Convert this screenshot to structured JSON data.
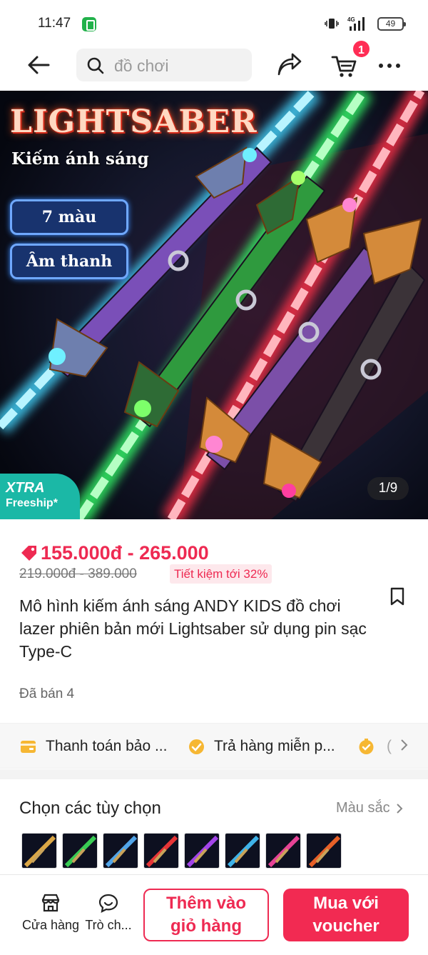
{
  "status_bar": {
    "time": "11:47",
    "network": "4G",
    "battery": "49"
  },
  "top_nav": {
    "search_placeholder": "đồ chơi",
    "cart_count": "1"
  },
  "product_image": {
    "headline": "LIGHTSABER",
    "subtitle": "Kiếm ánh sáng",
    "tags": [
      "7 màu",
      "Âm thanh"
    ],
    "badge_line1": "XTRA",
    "badge_line2": "Freeship*",
    "counter": "1/9"
  },
  "price": {
    "range": "155.000đ - 265.000",
    "original": "219.000đ - 389.000",
    "saving": "Tiết kiệm tới 32%"
  },
  "product": {
    "title": "Mô hình kiếm ánh sáng ANDY KIDS đồ chơi lazer phiên bản mới Lightsaber sử dụng pin sạc Type-C",
    "sold": "Đã bán 4"
  },
  "benefits": [
    {
      "label": "Thanh toán bảo ...",
      "icon": "wallet-icon"
    },
    {
      "label": "Trả hàng miễn p...",
      "icon": "return-badge-icon"
    },
    {
      "label": "(",
      "icon": "coin-icon"
    }
  ],
  "options": {
    "title": "Chọn các tùy chọn",
    "link": "Màu sắc",
    "thumbnail_colors": [
      "#f2b84b",
      "#3fe05a",
      "#5ab6ff",
      "#ff3a3a",
      "#b44bff",
      "#45c6ff",
      "#ff4aa3",
      "#ff6a2a"
    ]
  },
  "bottom_bar": {
    "store": "Cửa hàng",
    "chat": "Trò ch...",
    "add_to_cart": [
      "Thêm vào",
      "giỏ hàng"
    ],
    "buy": [
      "Mua với",
      "voucher"
    ]
  },
  "colors": {
    "accent": "#ee2a52",
    "freeship": "#1bb8a6"
  }
}
